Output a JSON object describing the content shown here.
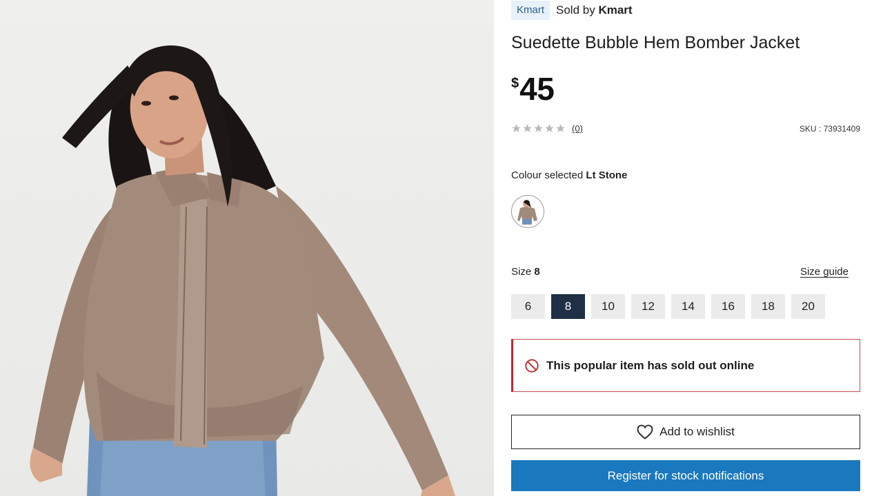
{
  "seller": {
    "badge": "Kmart",
    "prefix": "Sold by",
    "name": "Kmart"
  },
  "product": {
    "title": "Suedette Bubble Hem Bomber Jacket",
    "price_symbol": "$",
    "price_value": "45",
    "rating": {
      "stars": 0,
      "max": 5,
      "review_count": "(0)"
    },
    "sku": "SKU : 73931409"
  },
  "colour": {
    "label": "Colour selected",
    "value": "Lt Stone",
    "swatch_icon": "jacket-thumbnail"
  },
  "size": {
    "label": "Size",
    "selected": "8",
    "guide_label": "Size guide",
    "options": [
      "6",
      "8",
      "10",
      "12",
      "14",
      "16",
      "18",
      "20"
    ]
  },
  "alert": {
    "icon": "no-entry-icon",
    "text": "This popular item has sold out online"
  },
  "actions": {
    "wishlist_label": "Add to wishlist",
    "notify_label": "Register for stock notifications"
  },
  "colors": {
    "selected_size_bg": "#1f3045",
    "alert_border": "#c1272d",
    "notify_button": "#1a78bf",
    "seller_badge_bg": "#e8f1fa",
    "jacket": "#a08a7c"
  }
}
